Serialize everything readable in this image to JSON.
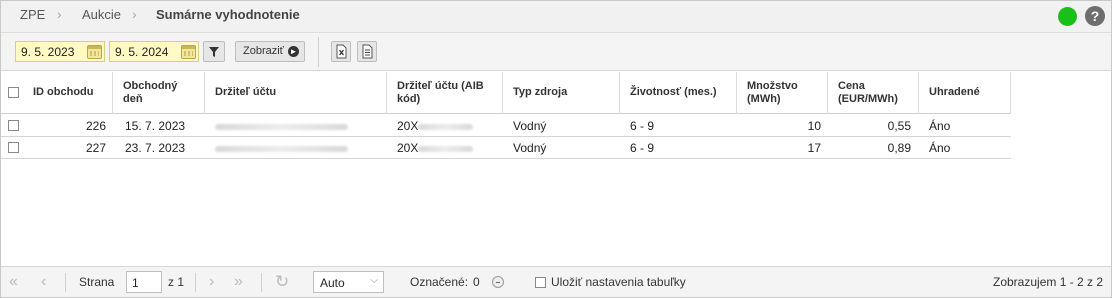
{
  "breadcrumb": {
    "items": [
      "ZPE",
      "Aukcie"
    ],
    "current": "Sumárne vyhodnotenie"
  },
  "toolbar": {
    "date_from": "9. 5. 2023",
    "date_to": "9. 5. 2024",
    "show_label": "Zobraziť"
  },
  "table": {
    "columns": [
      "ID obchodu",
      "Obchodný deň",
      "Držiteľ účtu",
      "Držiteľ účtu (AIB kód)",
      "Typ zdroja",
      "Životnosť (mes.)",
      "Množstvo (MWh)",
      "Cena (EUR/MWh)",
      "Uhradené"
    ],
    "rows": [
      {
        "id": "226",
        "day": "15. 7. 2023",
        "aib_prefix": "20X",
        "source": "Vodný",
        "life": "6 - 9",
        "qty": "10",
        "price": "0,55",
        "paid": "Áno"
      },
      {
        "id": "227",
        "day": "23. 7. 2023",
        "aib_prefix": "20X",
        "source": "Vodný",
        "life": "6 - 9",
        "qty": "17",
        "price": "0,89",
        "paid": "Áno"
      }
    ]
  },
  "footer": {
    "page_label": "Strana",
    "page_value": "1",
    "of_label": "z 1",
    "page_size": "Auto",
    "selected_label": "Označené:",
    "selected_count": "0",
    "save_settings_label": "Uložiť nastavenia tabuľky",
    "summary": "Zobrazujem 1 - 2 z 2"
  },
  "colors": {
    "status": "#19c019",
    "date_field": "#fff9c4"
  },
  "icons": [
    "status-online-icon",
    "help-icon",
    "calendar-icon",
    "filter-icon",
    "arrow-right-circle-icon",
    "excel-export-icon",
    "document-export-icon",
    "first-page-icon",
    "prev-page-icon",
    "next-page-icon",
    "last-page-icon",
    "refresh-icon",
    "minus-circle-icon"
  ]
}
